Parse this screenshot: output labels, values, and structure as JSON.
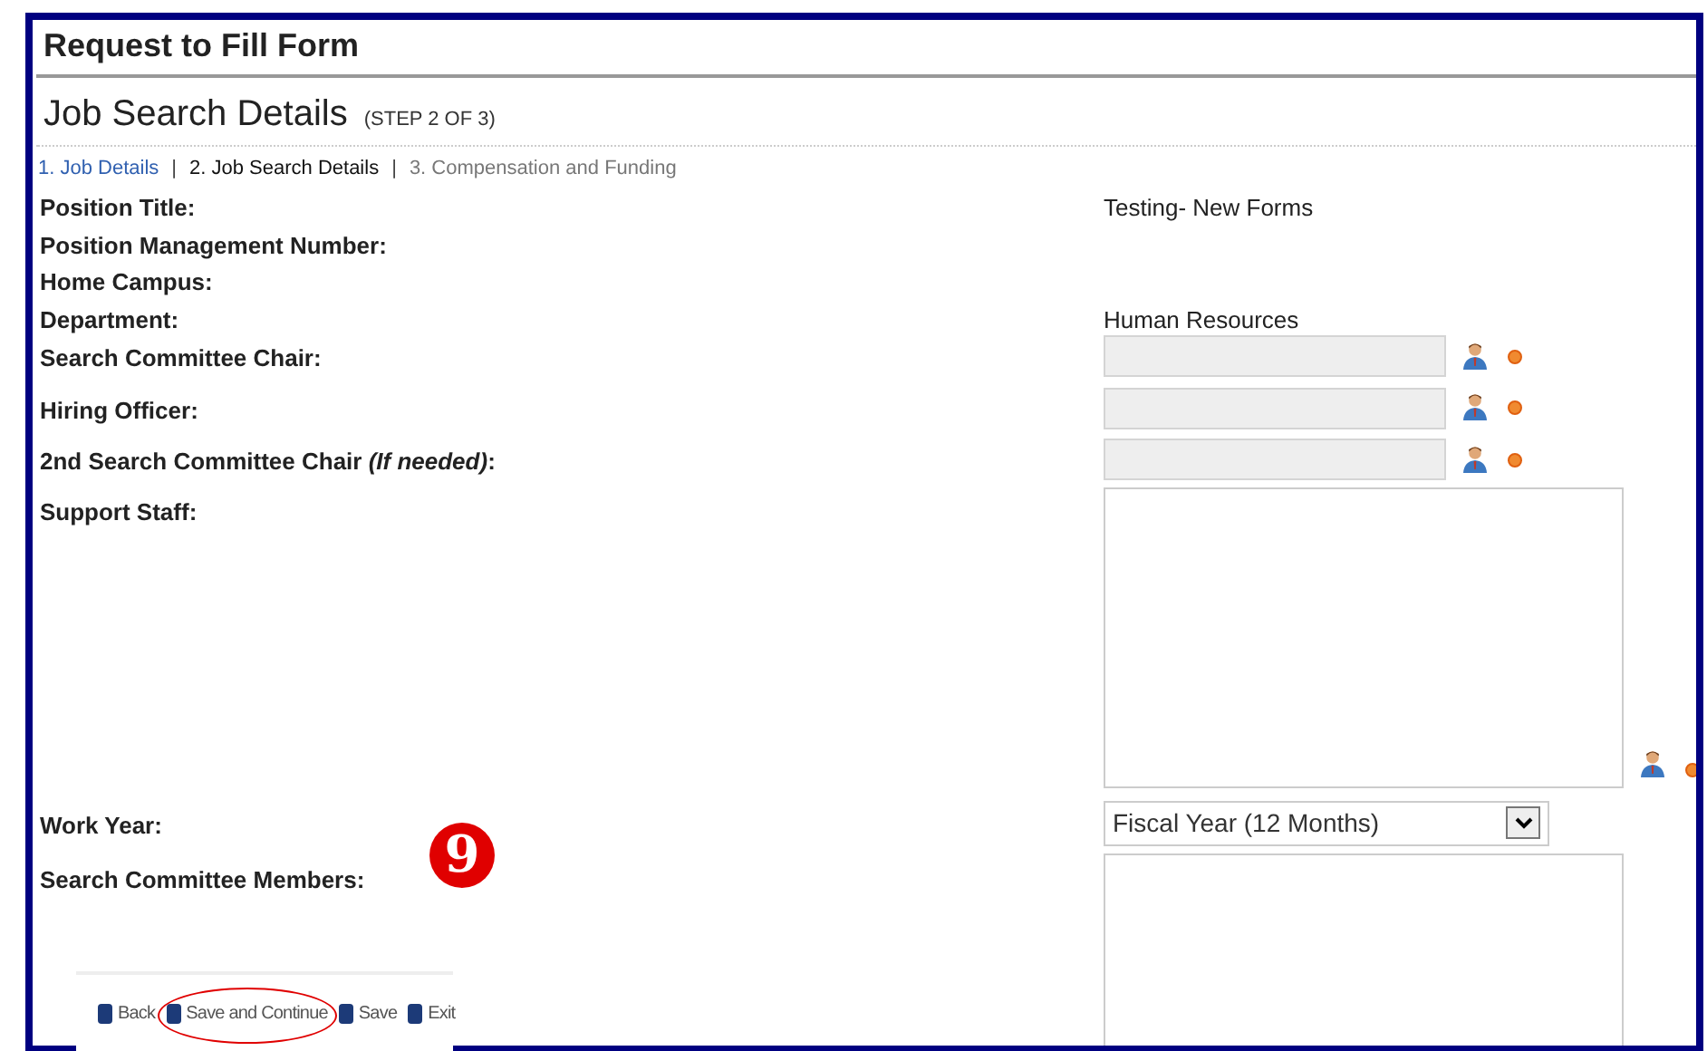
{
  "page_title": "Request to Fill Form",
  "section": {
    "title": "Job Search Details",
    "step": "(STEP 2 OF 3)"
  },
  "step_separator": "|",
  "steps": [
    {
      "label": "1. Job Details",
      "kind": "link"
    },
    {
      "label": "2. Job Search Details",
      "kind": "current"
    },
    {
      "label": "3. Compensation and Funding",
      "kind": "future"
    }
  ],
  "fields": [
    {
      "label": "Position Title:",
      "kind": "text",
      "value": "Testing- New Forms"
    },
    {
      "label": "Position Management Number:",
      "kind": "text"
    },
    {
      "label": "Home Campus:",
      "kind": "text"
    },
    {
      "label": "Department:",
      "kind": "text",
      "value": "Human Resources"
    },
    {
      "label": "Search Committee Chair:",
      "kind": "picker"
    },
    {
      "label": "Hiring Officer:",
      "kind": "picker"
    },
    {
      "label": "2nd Search Committee Chair *(If needed)*:",
      "kind": "picker"
    },
    {
      "label": "Support Staff:",
      "kind": "textarea_picker"
    },
    {
      "label": "Work Year:",
      "kind": "select",
      "value": "Fiscal Year (12 Months)"
    },
    {
      "label": "Search Committee Members:",
      "kind": "textarea"
    }
  ],
  "annotation": {
    "number": "9"
  },
  "footer_buttons": [
    {
      "label": "Back",
      "highlighted": false
    },
    {
      "label": "Save and Continue",
      "highlighted": true
    },
    {
      "label": "Save",
      "highlighted": false
    },
    {
      "label": "Exit",
      "highlighted": false
    }
  ]
}
